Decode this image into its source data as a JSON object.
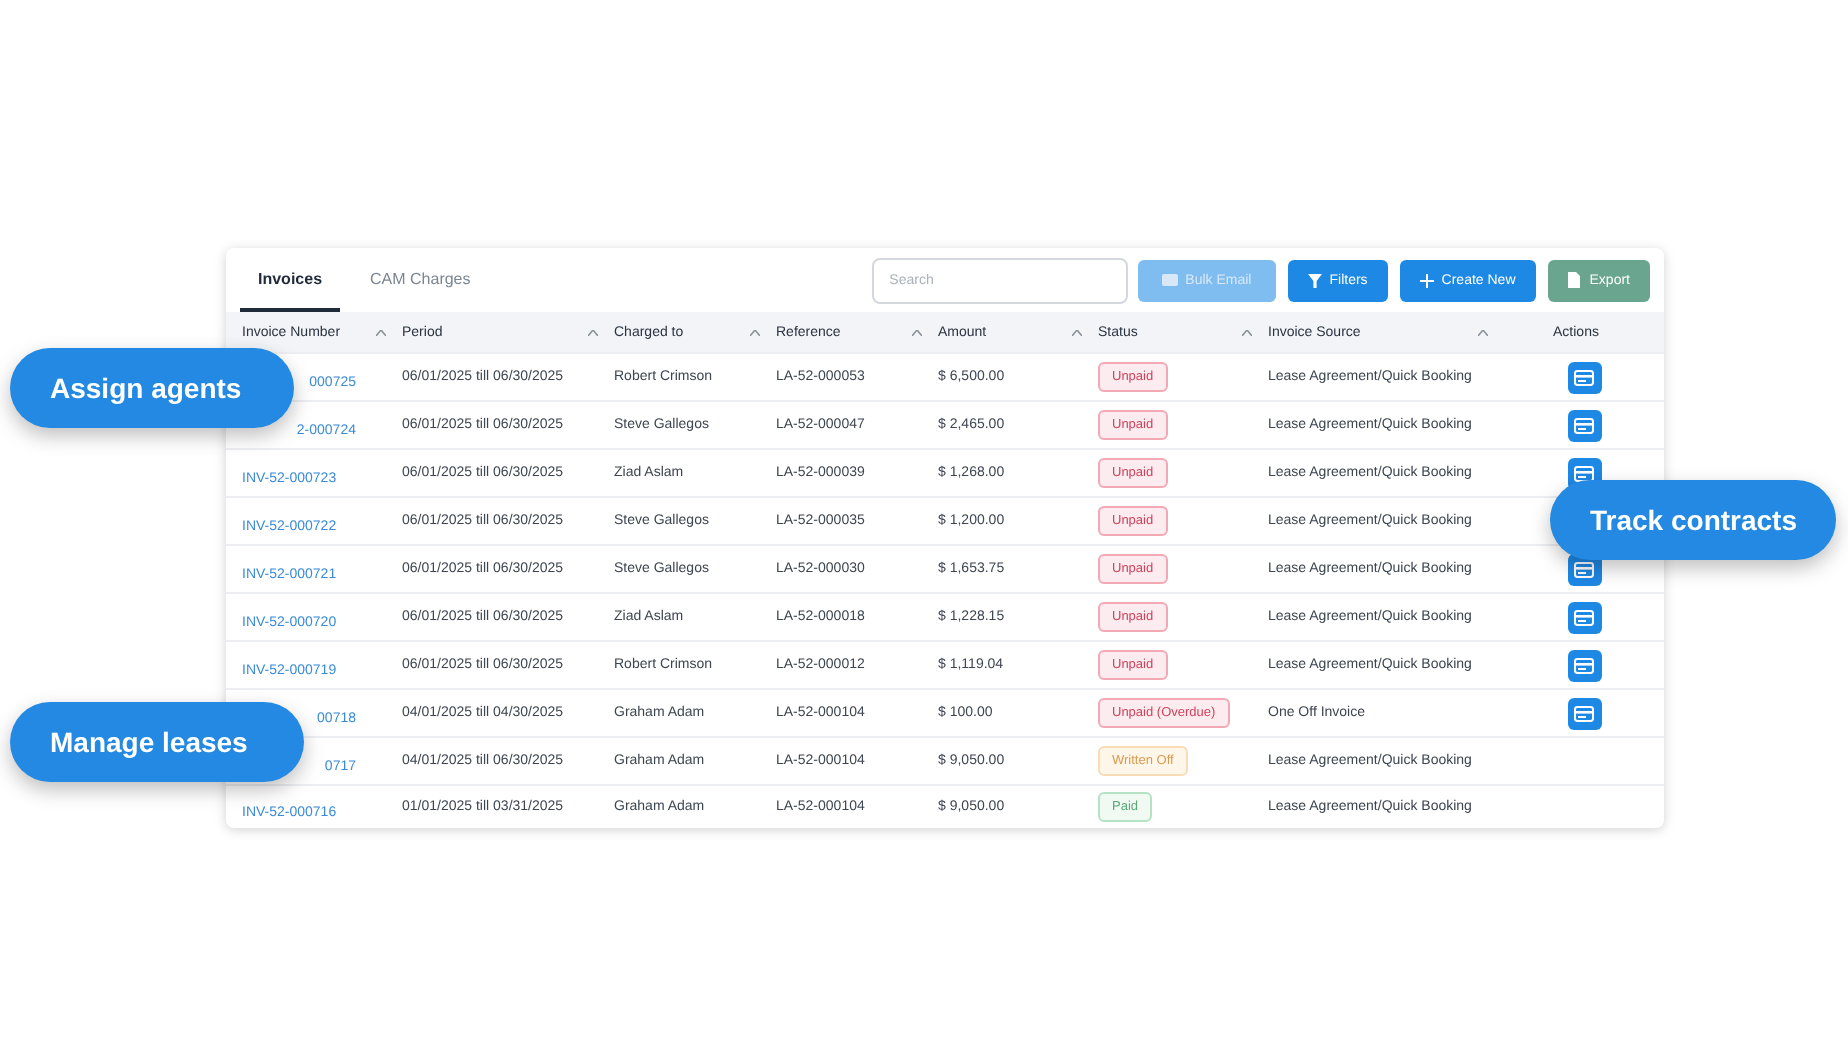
{
  "tabs": [
    {
      "label": "Invoices",
      "selected": true
    },
    {
      "label": "CAM Charges",
      "selected": false
    }
  ],
  "search": {
    "placeholder": "Search"
  },
  "buttons": [
    {
      "label": "Bulk Email",
      "kind": "email",
      "disabled": true
    },
    {
      "label": "Filters",
      "kind": "filter",
      "disabled": false
    },
    {
      "label": "Create New",
      "kind": "create",
      "disabled": false
    },
    {
      "label": "Export",
      "kind": "export",
      "disabled": false
    }
  ],
  "table": {
    "columns": [
      {
        "label": "Invoice Number",
        "sortable": true
      },
      {
        "label": "Period",
        "sortable": true
      },
      {
        "label": "Charged to",
        "sortable": true
      },
      {
        "label": "Reference",
        "sortable": true
      },
      {
        "label": "Amount",
        "sortable": true
      },
      {
        "label": "Status",
        "sortable": true
      },
      {
        "label": "Invoice Source",
        "sortable": true
      },
      {
        "label": "Actions",
        "sortable": false
      }
    ],
    "rows": [
      {
        "invoice": "000725",
        "clipped": true,
        "period": "06/01/2025 till 06/30/2025",
        "charged_to": "Robert Crimson",
        "reference": "LA-52-000053",
        "amount": "$ 6,500.00",
        "status": "Unpaid",
        "kind": "danger",
        "source": "Lease Agreement/Quick Booking",
        "action": true
      },
      {
        "invoice": "2-000724",
        "clipped": true,
        "period": "06/01/2025 till 06/30/2025",
        "charged_to": "Steve Gallegos",
        "reference": "LA-52-000047",
        "amount": "$ 2,465.00",
        "status": "Unpaid",
        "kind": "danger",
        "source": "Lease Agreement/Quick Booking",
        "action": true
      },
      {
        "invoice": "INV-52-000723",
        "clipped": false,
        "period": "06/01/2025 till 06/30/2025",
        "charged_to": "Ziad Aslam",
        "reference": "LA-52-000039",
        "amount": "$ 1,268.00",
        "status": "Unpaid",
        "kind": "danger",
        "source": "Lease Agreement/Quick Booking",
        "action": true
      },
      {
        "invoice": "INV-52-000722",
        "clipped": false,
        "period": "06/01/2025 till 06/30/2025",
        "charged_to": "Steve Gallegos",
        "reference": "LA-52-000035",
        "amount": "$ 1,200.00",
        "status": "Unpaid",
        "kind": "danger",
        "source": "Lease Agreement/Quick Booking"
      },
      {
        "invoice": "INV-52-000721",
        "clipped": false,
        "period": "06/01/2025 till 06/30/2025",
        "charged_to": "Steve Gallegos",
        "reference": "LA-52-000030",
        "amount": "$ 1,653.75",
        "status": "Unpaid",
        "kind": "danger",
        "source": "Lease Agreement/Quick Booking",
        "action": true
      },
      {
        "invoice": "INV-52-000720",
        "clipped": false,
        "period": "06/01/2025 till 06/30/2025",
        "charged_to": "Ziad Aslam",
        "reference": "LA-52-000018",
        "amount": "$ 1,228.15",
        "status": "Unpaid",
        "kind": "danger",
        "source": "Lease Agreement/Quick Booking",
        "action": true
      },
      {
        "invoice": "INV-52-000719",
        "clipped": false,
        "period": "06/01/2025 till 06/30/2025",
        "charged_to": "Robert Crimson",
        "reference": "LA-52-000012",
        "amount": "$ 1,119.04",
        "status": "Unpaid",
        "kind": "danger",
        "source": "Lease Agreement/Quick Booking",
        "action": true
      },
      {
        "invoice": "00718",
        "clipped": true,
        "period": "04/01/2025 till 04/30/2025",
        "charged_to": "Graham Adam",
        "reference": "LA-52-000104",
        "amount": "$ 100.00",
        "status": "Unpaid (Overdue)",
        "kind": "danger",
        "source": "One Off Invoice",
        "action": true
      },
      {
        "invoice": "0717",
        "clipped": true,
        "period": "04/01/2025 till 06/30/2025",
        "charged_to": "Graham Adam",
        "reference": "LA-52-000104",
        "amount": "$ 9,050.00",
        "status": "Written Off",
        "kind": "warning",
        "source": "Lease Agreement/Quick Booking",
        "action": false
      },
      {
        "invoice": "INV-52-000716",
        "clipped": false,
        "period": "01/01/2025 till 03/31/2025",
        "charged_to": "Graham Adam",
        "reference": "LA-52-000104",
        "amount": "$ 9,050.00",
        "status": "Paid",
        "kind": "success",
        "source": "Lease Agreement/Quick Booking",
        "action": false
      }
    ]
  },
  "callouts": [
    {
      "label": "Assign agents"
    },
    {
      "label": "Track contracts"
    },
    {
      "label": "Manage leases"
    }
  ]
}
